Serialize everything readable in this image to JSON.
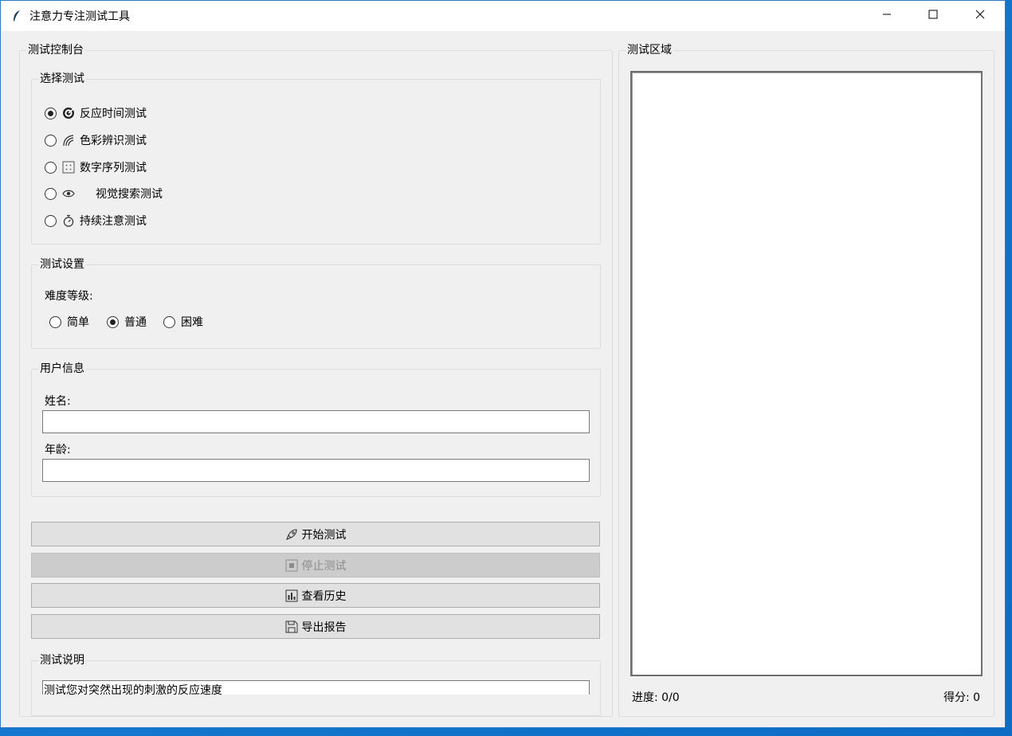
{
  "window": {
    "title": "注意力专注测试工具",
    "icon": "feather-icon",
    "controls": [
      "minimize-icon",
      "maximize-icon",
      "close-icon"
    ]
  },
  "control_panel": {
    "title": "测试控制台",
    "test_select": {
      "title": "选择测试",
      "selected": "反应时间测试",
      "options": [
        {
          "label": "反应时间测试",
          "icon": "target-icon",
          "checked": true
        },
        {
          "label": "色彩辨识测试",
          "icon": "rainbow-icon",
          "checked": false
        },
        {
          "label": "数字序列测试",
          "icon": "number-grid-icon",
          "checked": false
        },
        {
          "label": "视觉搜索测试",
          "icon": "eye-icon",
          "checked": false
        },
        {
          "label": "持续注意测试",
          "icon": "stopwatch-icon",
          "checked": false
        }
      ]
    },
    "settings": {
      "title": "测试设置",
      "difficulty_label": "难度等级:",
      "selected": "普通",
      "levels": [
        {
          "label": "简单",
          "checked": false
        },
        {
          "label": "普通",
          "checked": true
        },
        {
          "label": "困难",
          "checked": false
        }
      ]
    },
    "user_info": {
      "title": "用户信息",
      "name_label": "姓名:",
      "name_value": "",
      "age_label": "年龄:",
      "age_value": ""
    },
    "buttons": {
      "start": {
        "label": "开始测试",
        "icon": "rocket-icon",
        "enabled": true
      },
      "stop": {
        "label": "停止测试",
        "icon": "stop-icon",
        "enabled": false
      },
      "history": {
        "label": "查看历史",
        "icon": "bar-chart-icon",
        "enabled": true
      },
      "export": {
        "label": "导出报告",
        "icon": "floppy-disk-icon",
        "enabled": true
      }
    },
    "description": {
      "title": "测试说明",
      "text": "测试您对突然出现的刺激的反应速度"
    }
  },
  "test_area": {
    "title": "测试区域",
    "progress": "进度: 0/0",
    "score": "得分: 0"
  },
  "colors": {
    "window_bg": "#f0f0f0",
    "titlebar_bg": "#ffffff",
    "button_bg": "#e1e1e1",
    "button_disabled_bg": "#cccccc",
    "desktop_bg": "#0e6cc4"
  }
}
